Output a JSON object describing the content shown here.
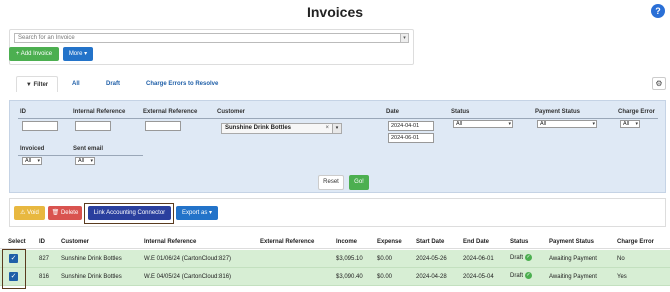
{
  "page": {
    "title": "Invoices",
    "help_icon": "?"
  },
  "search": {
    "placeholder": "Search for an Invoice"
  },
  "toolbar": {
    "add_label": "+ Add Invoice",
    "more_label": "More ▾"
  },
  "tabs": {
    "filter_label": "Filter",
    "items": [
      "All",
      "Draft",
      "Charge Errors to Resolve"
    ]
  },
  "filters": {
    "labels": {
      "id": "ID",
      "internal_reference": "Internal Reference",
      "external_reference": "External Reference",
      "customer": "Customer",
      "date": "Date",
      "status": "Status",
      "payment_status": "Payment Status",
      "charge_error": "Charge Error",
      "invoiced": "Invoiced",
      "sent_email": "Sent email"
    },
    "customer_value": "Sunshine Drink Bottles",
    "date_from": "2024-04-01",
    "date_to": "2024-06-01",
    "status_value": "All",
    "payment_status_value": "All",
    "charge_error_value": "All",
    "invoiced_value": "All",
    "sent_email_value": "All",
    "reset_label": "Reset",
    "go_label": "Go!"
  },
  "actions": {
    "void_label": "⚠ Void",
    "delete_label": "🗑 Delete",
    "link_label": "Link Accounting Connector",
    "export_label": "Export as ▾"
  },
  "table": {
    "headers": {
      "select": "Select",
      "id": "ID",
      "customer": "Customer",
      "internal_reference": "Internal Reference",
      "external_reference": "External Reference",
      "income": "Income",
      "expense": "Expense",
      "start_date": "Start Date",
      "end_date": "End Date",
      "status": "Status",
      "payment_status": "Payment Status",
      "charge_error": "Charge Error"
    },
    "rows": [
      {
        "id": "827",
        "customer": "Sunshine Drink Bottles",
        "internal_reference": "W.E 01/06/24 (CartonCloud:827)",
        "external_reference": "",
        "income": "$3,095.10",
        "expense": "$0.00",
        "start_date": "2024-05-26",
        "end_date": "2024-06-01",
        "status": "Draft",
        "payment_status": "Awaiting Payment",
        "charge_error": "No"
      },
      {
        "id": "816",
        "customer": "Sunshine Drink Bottles",
        "internal_reference": "W.E 04/05/24 (CartonCloud:816)",
        "external_reference": "",
        "income": "$3,090.40",
        "expense": "$0.00",
        "start_date": "2024-04-28",
        "end_date": "2024-05-04",
        "status": "Draft",
        "payment_status": "Awaiting Payment",
        "charge_error": "Yes"
      }
    ]
  }
}
